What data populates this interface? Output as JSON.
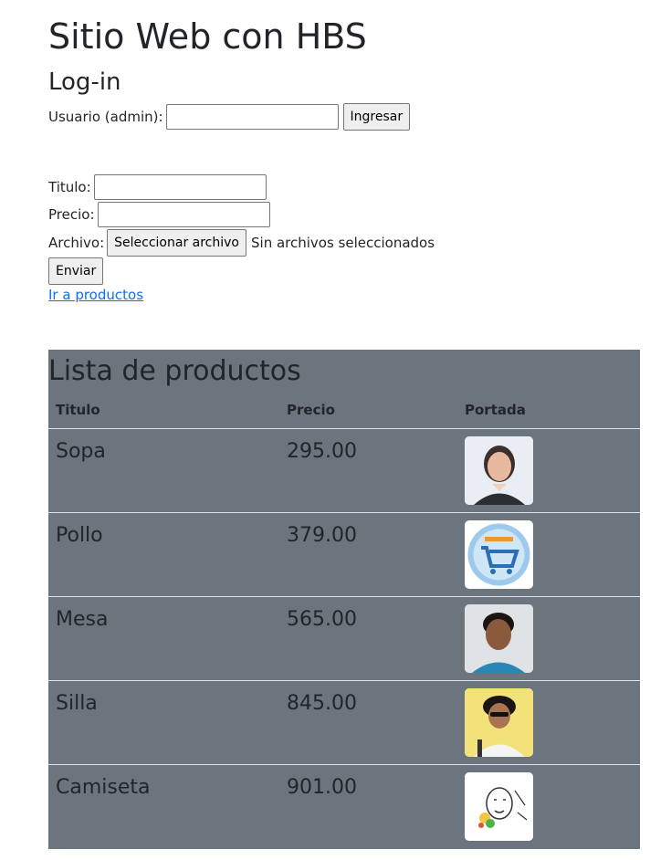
{
  "site_title": "Sitio Web con HBS",
  "login": {
    "title": "Log-in",
    "user_label": "Usuario (admin):",
    "user_value": "",
    "submit_label": "Ingresar"
  },
  "product_form": {
    "title_label": "Titulo:",
    "title_value": "",
    "price_label": "Precio:",
    "price_value": "",
    "file_label": "Archivo:",
    "file_button_label": "Seleccionar archivo",
    "file_status": "Sin archivos seleccionados",
    "submit_label": "Enviar"
  },
  "nav_link": "Ir a productos",
  "product_list": {
    "title": "Lista de productos",
    "headers": [
      "Titulo",
      "Precio",
      "Portada"
    ],
    "rows": [
      {
        "titulo": "Sopa",
        "precio": "295.00",
        "portada_icon": "woman-portrait-image"
      },
      {
        "titulo": "Pollo",
        "precio": "379.00",
        "portada_icon": "shopping-cart-logo-image"
      },
      {
        "titulo": "Mesa",
        "precio": "565.00",
        "portada_icon": "man-portrait-image"
      },
      {
        "titulo": "Silla",
        "precio": "845.00",
        "portada_icon": "man-sunglasses-image"
      },
      {
        "titulo": "Camiseta",
        "precio": "901.00",
        "portada_icon": "sketch-drawing-image"
      }
    ]
  },
  "colors": {
    "table_bg": "#6c757d",
    "link": "#0d6efd",
    "row_border": "#dee2e6"
  }
}
